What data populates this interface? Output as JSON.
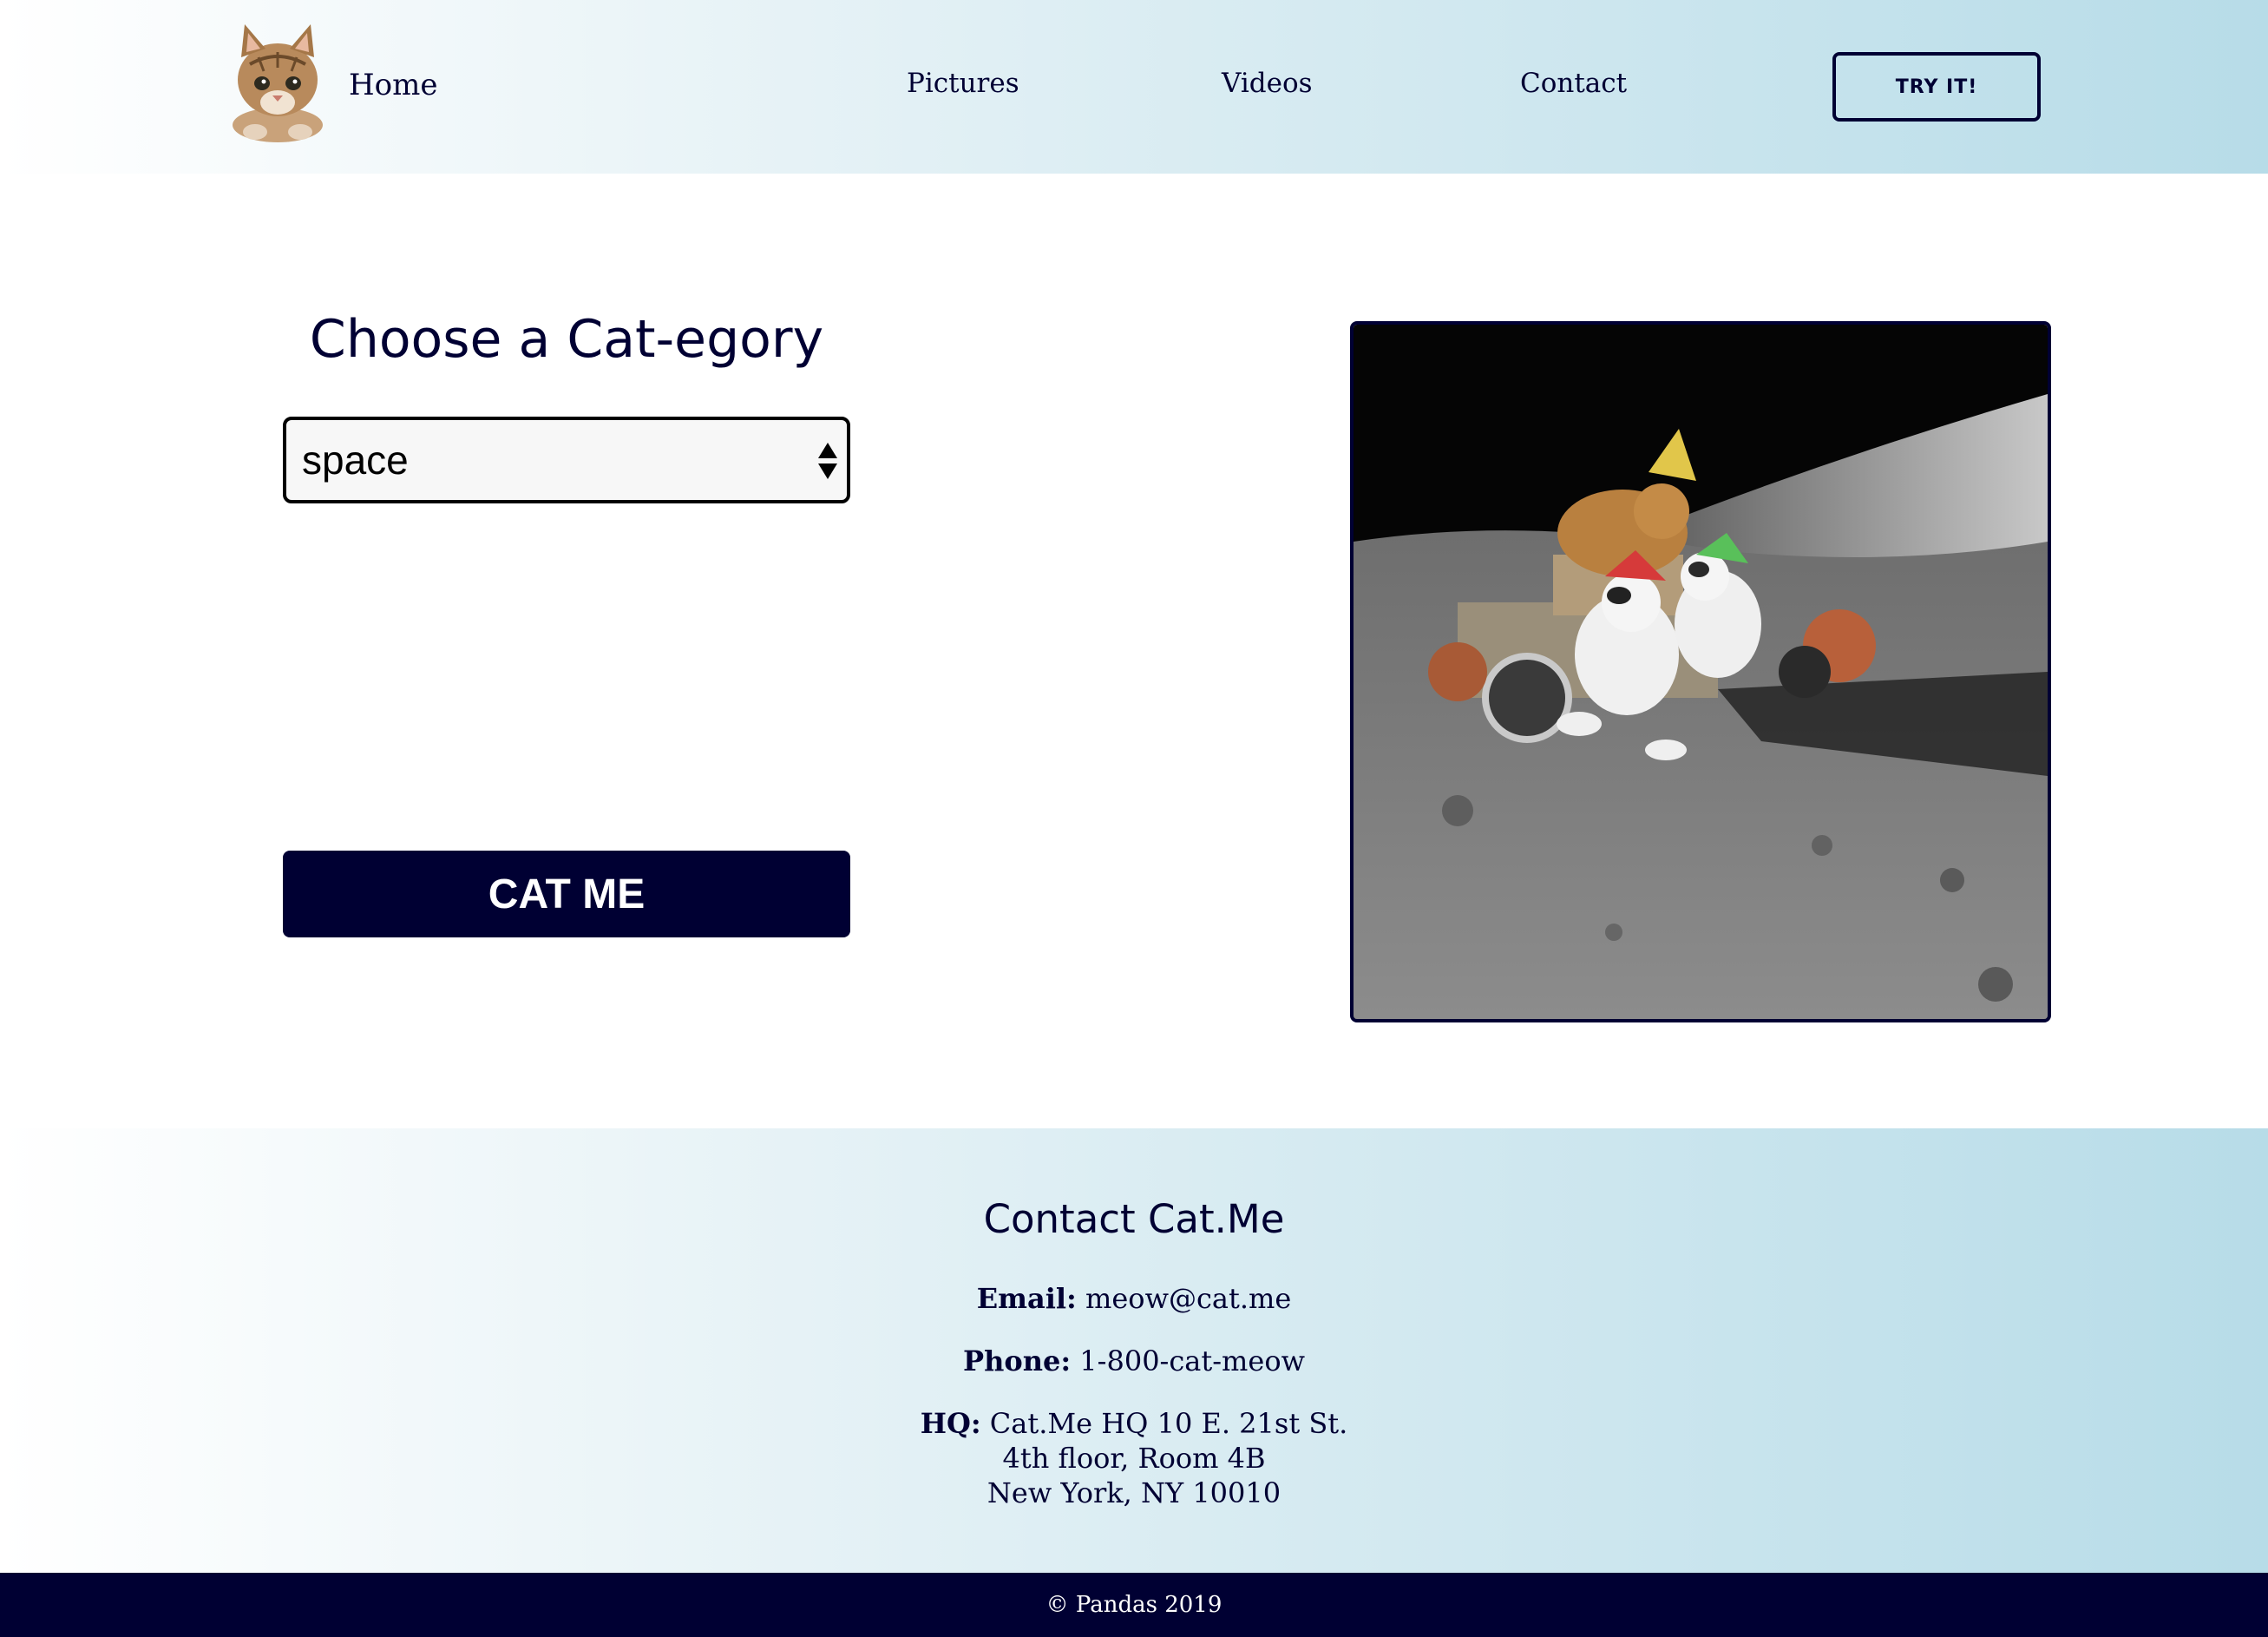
{
  "header": {
    "logo_icon": "kitten-logo-icon",
    "nav": {
      "home": "Home",
      "pictures": "Pictures",
      "videos": "Videos",
      "contact": "Contact"
    },
    "try_button": "TRY IT!"
  },
  "main": {
    "title": "Choose a Cat-egory",
    "select": {
      "value": "space",
      "arrow_icon": "select-arrows-icon"
    },
    "cat_me_button": "CAT ME",
    "image_icon": "cats-on-moon-rover-photo"
  },
  "contact": {
    "title": "Contact Cat.Me",
    "email_label": "Email:",
    "email_value": "meow@cat.me",
    "phone_label": "Phone:",
    "phone_value": "1-800-cat-meow",
    "hq_label": "HQ:",
    "hq_line1": "Cat.Me HQ 10 E. 21st St.",
    "hq_line2": "4th floor, Room 4B",
    "hq_line3": "New York, NY 10010"
  },
  "footer": {
    "copyright": "© Pandas 2019"
  },
  "colors": {
    "navy": "#000033",
    "gradient_start": "#ffffff",
    "gradient_end": "#b7dce8",
    "select_bg": "#f7f7f7"
  }
}
